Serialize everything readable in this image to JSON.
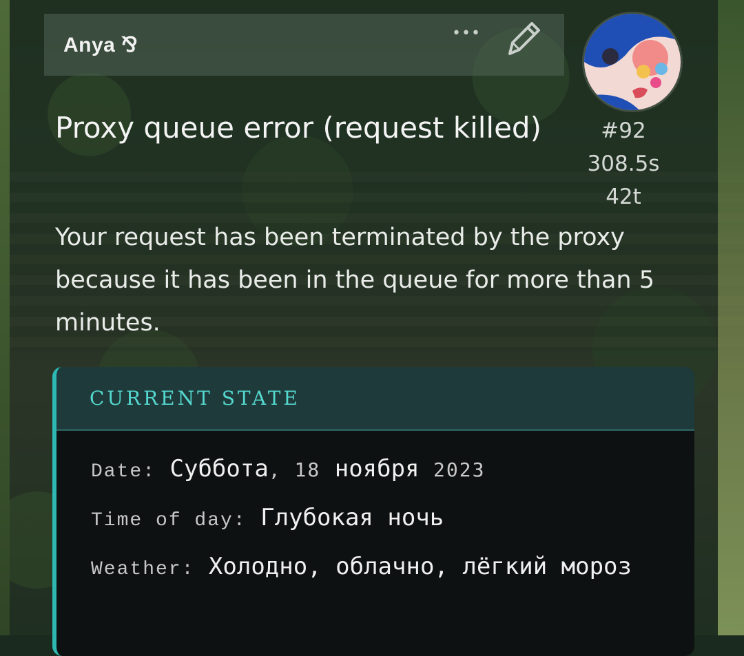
{
  "post": {
    "author": "Anya ⅋",
    "more_label": "•••",
    "title": "Proxy queue error (request killed)",
    "meta": {
      "number": "#92",
      "duration": "308.5s",
      "tokens": "42t"
    },
    "message": "Your request has been terminated by the proxy because it has been in the queue for more than 5 minutes."
  },
  "state": {
    "heading": "CURRENT STATE",
    "date_label": "Date:",
    "date_day": "Суббота",
    "date_num": "18",
    "date_month": "ноября",
    "date_year": "2023",
    "time_label": "Time of day:",
    "time_value": "Глубокая ночь",
    "weather_label": "Weather:",
    "weather_value": "Холодно, облачно, лёгкий мороз"
  },
  "colors": {
    "accent": "#2fb8b2",
    "heading": "#55d8cf"
  }
}
